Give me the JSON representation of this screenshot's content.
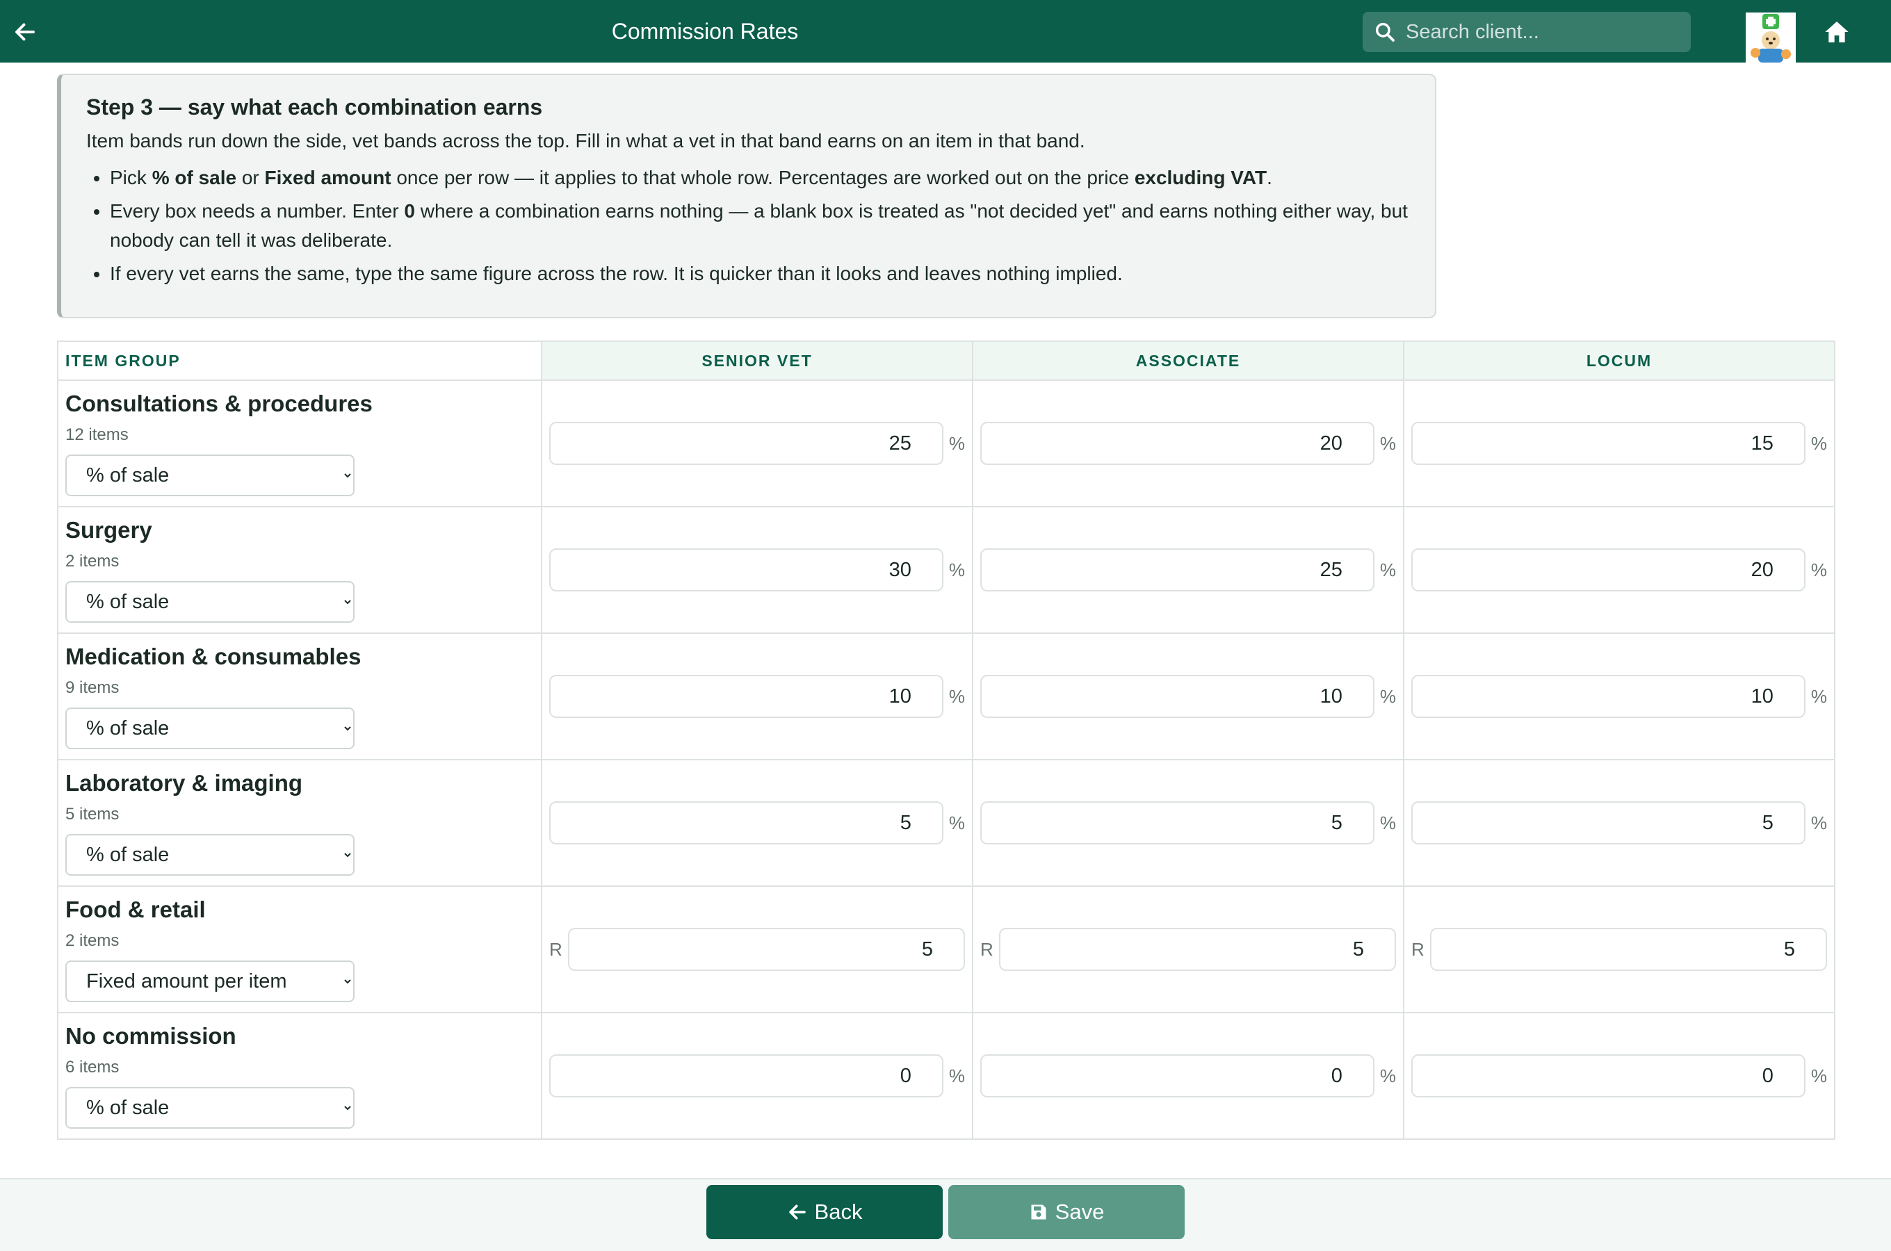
{
  "header": {
    "title": "Commission Rates",
    "search_placeholder": "Search client..."
  },
  "colors": {
    "brand": "#0b5e4a",
    "save_button": "#5a9a86"
  },
  "callout": {
    "title": "Step 3 — say what each combination earns",
    "intro": "Item bands run down the side, vet bands across the top. Fill in what a vet in that band earns on an item in that band.",
    "bullet1": {
      "t1": "Pick ",
      "b1": "% of sale",
      "t2": " or ",
      "b2": "Fixed amount",
      "t3": " once per row — it applies to that whole row. Percentages are worked out on the price ",
      "b3": "excluding VAT",
      "t4": "."
    },
    "bullet2": {
      "t1": "Every box needs a number. Enter ",
      "b1": "0",
      "t2": " where a combination earns nothing — a blank box is treated as \"not decided yet\" and earns nothing either way, but nobody can tell it was deliberate."
    },
    "bullet3": "If every vet earns the same, type the same figure across the row. It is quicker than it looks and leaves nothing implied."
  },
  "table": {
    "headers": [
      "ITEM GROUP",
      "SENIOR VET",
      "ASSOCIATE",
      "LOCUM"
    ],
    "mode_options": [
      "% of sale",
      "Fixed amount per item"
    ],
    "percent_unit": "%",
    "currency_prefix": "R",
    "rows": [
      {
        "name": "Consultations & procedures",
        "count": "12 items",
        "mode": "% of sale",
        "values": [
          "25",
          "20",
          "15"
        ]
      },
      {
        "name": "Surgery",
        "count": "2 items",
        "mode": "% of sale",
        "values": [
          "30",
          "25",
          "20"
        ]
      },
      {
        "name": "Medication & consumables",
        "count": "9 items",
        "mode": "% of sale",
        "values": [
          "10",
          "10",
          "10"
        ]
      },
      {
        "name": "Laboratory & imaging",
        "count": "5 items",
        "mode": "% of sale",
        "values": [
          "5",
          "5",
          "5"
        ]
      },
      {
        "name": "Food & retail",
        "count": "2 items",
        "mode": "Fixed amount per item",
        "values": [
          "5",
          "5",
          "5"
        ]
      },
      {
        "name": "No commission",
        "count": "6 items",
        "mode": "% of sale",
        "values": [
          "0",
          "0",
          "0"
        ]
      }
    ]
  },
  "footer": {
    "back_label": "Back",
    "save_label": "Save"
  }
}
